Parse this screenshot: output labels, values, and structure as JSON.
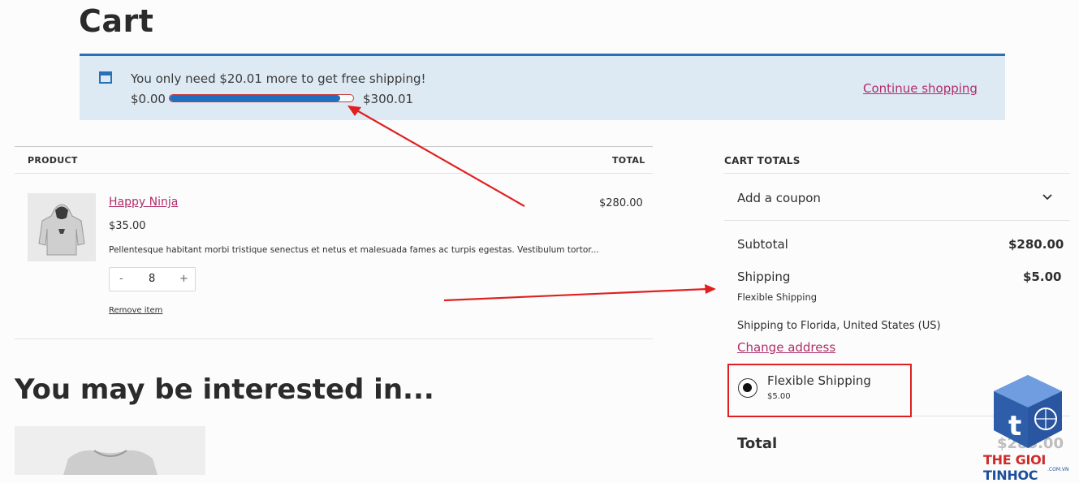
{
  "page": {
    "title": "Cart"
  },
  "notice": {
    "message": "You only need $20.01 more to get free shipping!",
    "min_label": "$0.00",
    "max_label": "$300.01",
    "progress_fraction": 0.93,
    "continue_link": "Continue shopping",
    "accent_color": "#2771b8",
    "icon": "window-icon"
  },
  "cart_table": {
    "headers": {
      "product": "PRODUCT",
      "total": "TOTAL"
    },
    "items": [
      {
        "name": "Happy Ninja",
        "price": "$35.00",
        "description": "Pellentesque habitant morbi tristique senectus et netus et malesuada fames ac turpis egestas. Vestibulum tortor...",
        "quantity": "8",
        "minus": "-",
        "plus": "+",
        "remove_label": "Remove item",
        "line_total": "$280.00",
        "image_icon": "hoodie-image"
      }
    ]
  },
  "recommendations": {
    "heading": "You may be interested in..."
  },
  "totals": {
    "title": "CART TOTALS",
    "coupon_label": "Add a coupon",
    "subtotal_label": "Subtotal",
    "subtotal_value": "$280.00",
    "shipping_label": "Shipping",
    "shipping_value": "$5.00",
    "shipping_method": "Flexible Shipping",
    "shipping_to": "Shipping to Florida, United States (US)",
    "change_address": "Change address",
    "option": {
      "name": "Flexible Shipping",
      "price": "$5.00",
      "selected": true
    },
    "total_label": "Total",
    "total_value": "$285.00"
  },
  "watermark": {
    "part1": "THE GIOI ",
    "part2": "TINHOC",
    "sub": ".COM.VN"
  },
  "annotation_color": "#e02020"
}
